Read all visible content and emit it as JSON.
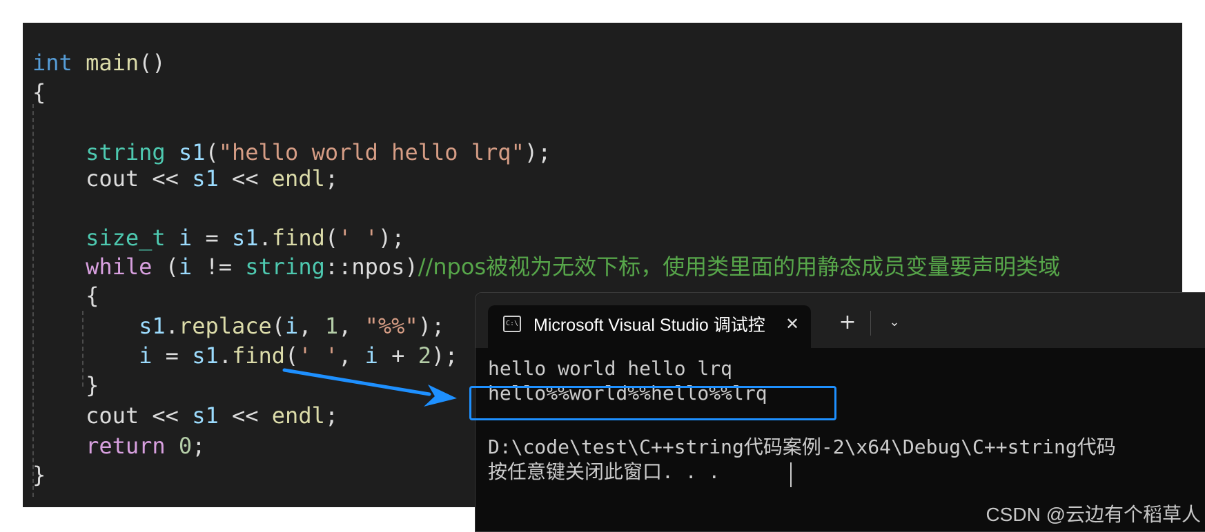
{
  "editor": {
    "lines": [
      {
        "tokens": [
          {
            "t": "int",
            "c": "kw"
          },
          {
            "t": " ",
            "c": "pun"
          },
          {
            "t": "main",
            "c": "fn"
          },
          {
            "t": "()",
            "c": "pun"
          }
        ]
      },
      {
        "tokens": [
          {
            "t": "{",
            "c": "pun"
          }
        ]
      },
      {
        "tokens": [
          {
            "t": "    ",
            "c": "pun"
          },
          {
            "t": "string",
            "c": "ty"
          },
          {
            "t": " ",
            "c": "pun"
          },
          {
            "t": "s1",
            "c": "var"
          },
          {
            "t": "(",
            "c": "pun"
          },
          {
            "t": "\"hello world hello lrq\"",
            "c": "str"
          },
          {
            "t": ");",
            "c": "pun"
          }
        ]
      },
      {
        "tokens": [
          {
            "t": "    cout << ",
            "c": "pun"
          },
          {
            "t": "s1",
            "c": "var"
          },
          {
            "t": " << ",
            "c": "pun"
          },
          {
            "t": "endl",
            "c": "fn"
          },
          {
            "t": ";",
            "c": "pun"
          }
        ]
      },
      {
        "tokens": []
      },
      {
        "tokens": [
          {
            "t": "    ",
            "c": "pun"
          },
          {
            "t": "size_t",
            "c": "ty"
          },
          {
            "t": " ",
            "c": "pun"
          },
          {
            "t": "i",
            "c": "var"
          },
          {
            "t": " = ",
            "c": "pun"
          },
          {
            "t": "s1",
            "c": "var"
          },
          {
            "t": ".",
            "c": "pun"
          },
          {
            "t": "find",
            "c": "fn"
          },
          {
            "t": "(",
            "c": "pun"
          },
          {
            "t": "' '",
            "c": "str"
          },
          {
            "t": ");",
            "c": "pun"
          }
        ]
      },
      {
        "tokens": [
          {
            "t": "    ",
            "c": "pun"
          },
          {
            "t": "while",
            "c": "kwp"
          },
          {
            "t": " (",
            "c": "pun"
          },
          {
            "t": "i",
            "c": "var"
          },
          {
            "t": " != ",
            "c": "pun"
          },
          {
            "t": "string",
            "c": "ty"
          },
          {
            "t": "::npos)",
            "c": "pun"
          },
          {
            "t": "//npos被视为无效下标，使用类里面的用静态成员变量要声明类域",
            "c": "cmt"
          }
        ]
      },
      {
        "tokens": [
          {
            "t": "    {",
            "c": "pun"
          }
        ]
      },
      {
        "tokens": [
          {
            "t": "        ",
            "c": "pun"
          },
          {
            "t": "s1",
            "c": "var"
          },
          {
            "t": ".",
            "c": "pun"
          },
          {
            "t": "replace",
            "c": "fn"
          },
          {
            "t": "(",
            "c": "pun"
          },
          {
            "t": "i",
            "c": "var"
          },
          {
            "t": ", ",
            "c": "pun"
          },
          {
            "t": "1",
            "c": "num"
          },
          {
            "t": ", ",
            "c": "pun"
          },
          {
            "t": "\"%%\"",
            "c": "str"
          },
          {
            "t": ");",
            "c": "pun"
          }
        ]
      },
      {
        "tokens": [
          {
            "t": "        ",
            "c": "pun"
          },
          {
            "t": "i",
            "c": "var"
          },
          {
            "t": " = ",
            "c": "pun"
          },
          {
            "t": "s1",
            "c": "var"
          },
          {
            "t": ".",
            "c": "pun"
          },
          {
            "t": "find",
            "c": "fn"
          },
          {
            "t": "(",
            "c": "pun"
          },
          {
            "t": "' '",
            "c": "str"
          },
          {
            "t": ", ",
            "c": "pun"
          },
          {
            "t": "i",
            "c": "var"
          },
          {
            "t": " + ",
            "c": "pun"
          },
          {
            "t": "2",
            "c": "num"
          },
          {
            "t": ");",
            "c": "pun"
          }
        ]
      },
      {
        "tokens": [
          {
            "t": "    }",
            "c": "pun"
          }
        ]
      },
      {
        "tokens": [
          {
            "t": "    cout << ",
            "c": "pun"
          },
          {
            "t": "s1",
            "c": "var"
          },
          {
            "t": " << ",
            "c": "pun"
          },
          {
            "t": "endl",
            "c": "fn"
          },
          {
            "t": ";",
            "c": "pun"
          }
        ]
      },
      {
        "tokens": [
          {
            "t": "    ",
            "c": "pun"
          },
          {
            "t": "return",
            "c": "kwp"
          },
          {
            "t": " ",
            "c": "pun"
          },
          {
            "t": "0",
            "c": "num"
          },
          {
            "t": ";",
            "c": "pun"
          }
        ]
      },
      {
        "tokens": [
          {
            "t": "}",
            "c": "pun"
          }
        ]
      }
    ]
  },
  "terminal": {
    "tab_icon": "C:\\",
    "tab_title": "Microsoft Visual Studio 调试控",
    "close_glyph": "✕",
    "new_tab_glyph": "+",
    "dropdown_glyph": "⌄",
    "output": [
      "hello world hello lrq",
      "hello%%world%%hello%%lrq",
      "",
      "D:\\code\\test\\C++string代码案例-2\\x64\\Debug\\C++string代码",
      "按任意键关闭此窗口. . ."
    ]
  },
  "annotation": {
    "color": "#1e90ff"
  },
  "watermark": "CSDN @云边有个稻草人"
}
